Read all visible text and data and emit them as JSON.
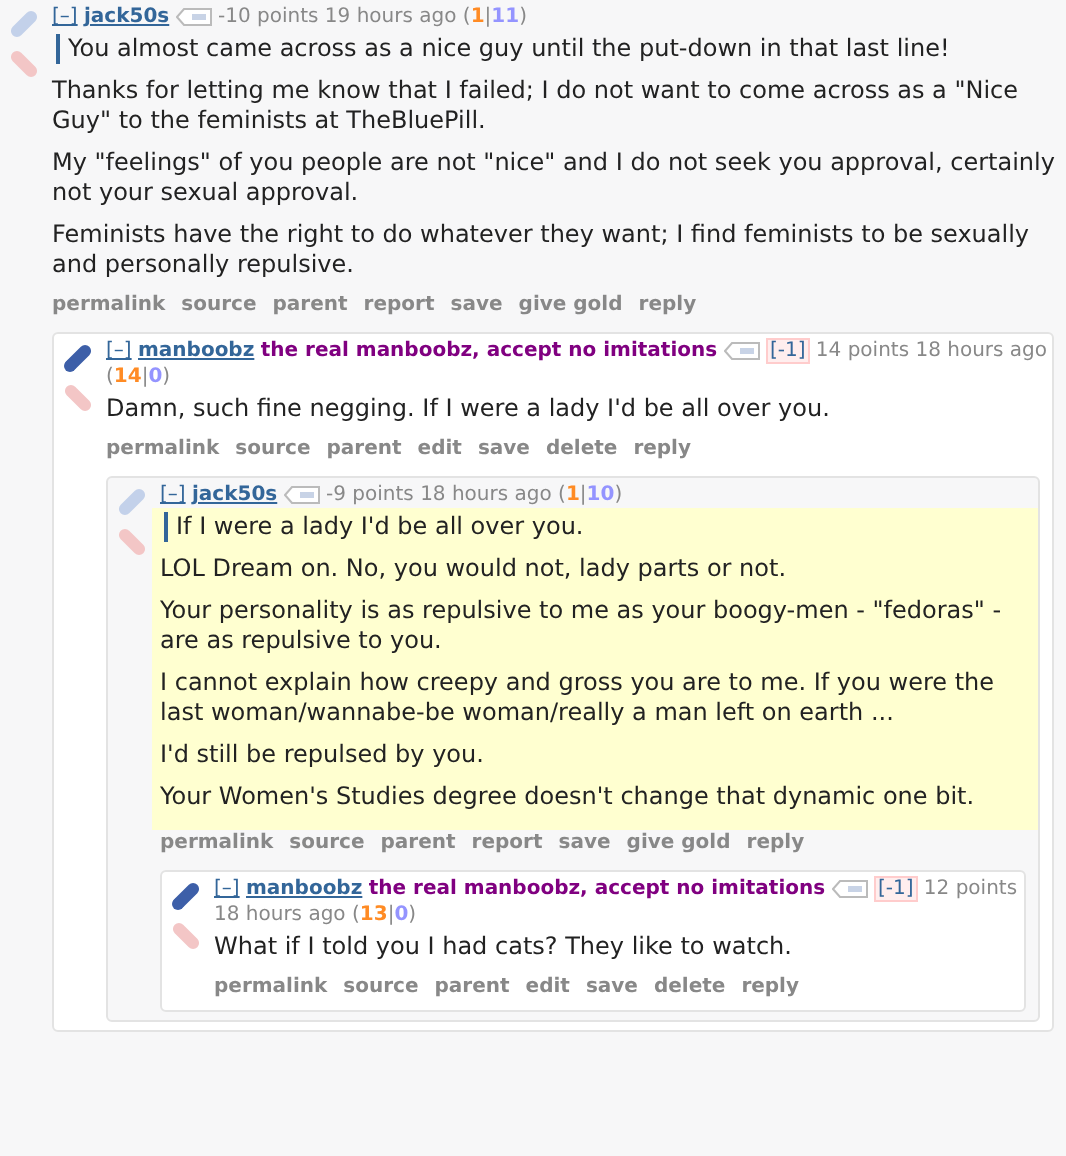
{
  "comments": [
    {
      "collapse": "[–]",
      "author": "jack50s",
      "upvoted": false,
      "points": "-10 points",
      "time": "19 hours ago",
      "tally": {
        "open": "(",
        "ups": "1",
        "sep": "|",
        "downs": "11",
        "close": ")"
      },
      "highlighted": false,
      "body": [
        {
          "kind": "quote",
          "text": "You almost came across as a nice guy until the put-down in that last line!"
        },
        {
          "kind": "text",
          "text": "Thanks for letting me know that I failed; I do not want to come across as a \"Nice Guy\" to the feminists at TheBluePill."
        },
        {
          "kind": "text",
          "text": "My \"feelings\" of you people are not \"nice\" and I do not seek you approval, certainly not your sexual approval."
        },
        {
          "kind": "text",
          "text": "Feminists have the right to do whatever they want; I find feminists to be sexually and personally repulsive."
        }
      ],
      "actions": [
        "permalink",
        "source",
        "parent",
        "report",
        "save",
        "give gold",
        "reply"
      ],
      "children": [
        {
          "collapse": "[–]",
          "author": "manboobz",
          "flair": "the real manboobz, accept no imitations",
          "badge": "[-1]",
          "upvoted": true,
          "points": "14 points",
          "time": "18 hours ago",
          "tally": {
            "open": "(",
            "ups": "14",
            "sep": "|",
            "downs": "0",
            "close": ")"
          },
          "highlighted": false,
          "body": [
            {
              "kind": "text",
              "text": "Damn, such fine negging. If I were a lady I'd be all over you."
            }
          ],
          "actions": [
            "permalink",
            "source",
            "parent",
            "edit",
            "save",
            "delete",
            "reply"
          ],
          "children": [
            {
              "collapse": "[–]",
              "author": "jack50s",
              "upvoted": false,
              "points": "-9 points",
              "time": "18 hours ago",
              "tally": {
                "open": "(",
                "ups": "1",
                "sep": "|",
                "downs": "10",
                "close": ")"
              },
              "highlighted": true,
              "body": [
                {
                  "kind": "quote",
                  "text": "If I were a lady I'd be all over you."
                },
                {
                  "kind": "text",
                  "text": "LOL Dream on. No, you would not, lady parts or not."
                },
                {
                  "kind": "text",
                  "text": "Your personality is as repulsive to me as your boogy-men - \"fedoras\" - are as repulsive to you."
                },
                {
                  "kind": "text",
                  "text": "I cannot explain how creepy and gross you are to me. If you were the last woman/wannabe-be woman/really a man left on earth ..."
                },
                {
                  "kind": "text",
                  "text": "I'd still be repulsed by you."
                },
                {
                  "kind": "text",
                  "text": "Your Women's Studies degree doesn't change that dynamic one bit."
                }
              ],
              "actions": [
                "permalink",
                "source",
                "parent",
                "report",
                "save",
                "give gold",
                "reply"
              ],
              "children": [
                {
                  "collapse": "[–]",
                  "author": "manboobz",
                  "flair": "the real manboobz, accept no imitations",
                  "badge": "[-1]",
                  "upvoted": true,
                  "points": "12 points",
                  "time": "18 hours ago",
                  "tally": {
                    "open": "(",
                    "ups": "13",
                    "sep": "|",
                    "downs": "0",
                    "close": ")"
                  },
                  "highlighted": false,
                  "body": [
                    {
                      "kind": "text",
                      "text": "What if I told you I had cats? They like to watch."
                    }
                  ],
                  "actions": [
                    "permalink",
                    "source",
                    "parent",
                    "edit",
                    "save",
                    "delete",
                    "reply"
                  ]
                }
              ]
            }
          ]
        }
      ]
    }
  ]
}
